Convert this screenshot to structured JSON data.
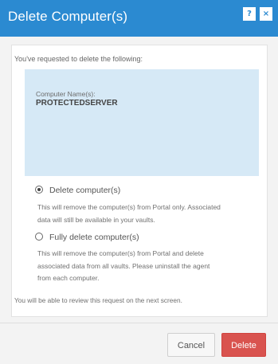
{
  "dialog": {
    "title": "Delete Computer(s)",
    "help_button": "?",
    "close_button": "×",
    "intro_text": "You've requested to delete the following:",
    "computer_names_label": "Computer Name(s):",
    "computer_names": [
      "PROTECTEDSERVER"
    ],
    "options": [
      {
        "label": "Delete computer(s)",
        "selected": true,
        "description_lines": [
          "This will remove the computer(s) from Portal only. Associated",
          "data will still be available in your vaults."
        ]
      },
      {
        "label": "Fully delete computer(s)",
        "selected": false,
        "description_lines": [
          "This will remove the computer(s) from Portal and delete",
          "associated data from all vaults. Please uninstall the agent",
          "from each computer."
        ]
      }
    ],
    "review_note": "You will be able to review this request on the next screen.",
    "buttons": {
      "cancel": "Cancel",
      "delete": "Delete"
    }
  },
  "colors": {
    "titlebar": "#2b8ad1",
    "names_box": "#d6e9f6",
    "delete_button": "#d9534f"
  }
}
